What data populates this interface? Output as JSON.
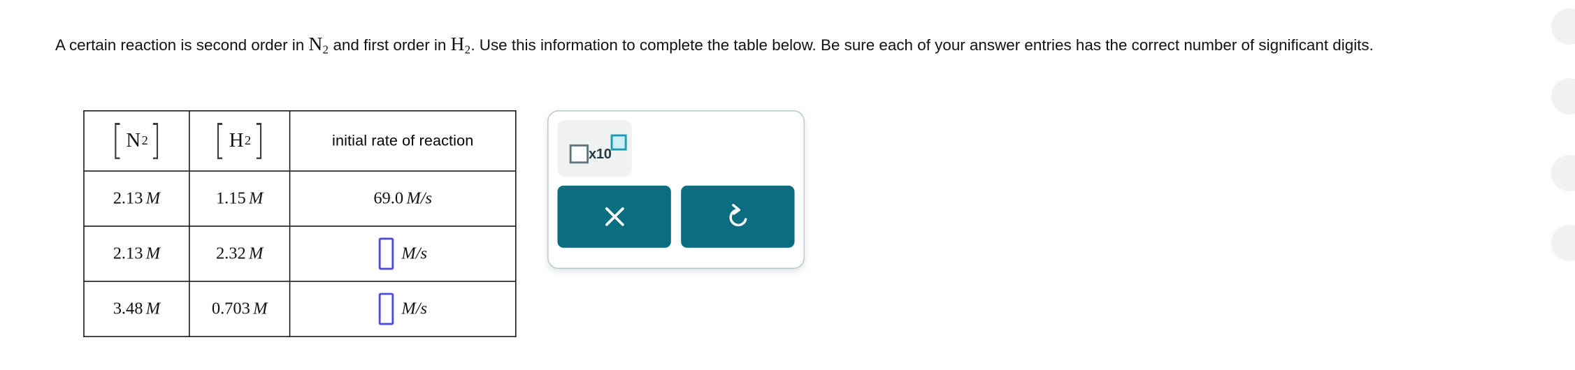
{
  "prompt": {
    "part1": "A certain reaction is second order in ",
    "species1": "N",
    "species1_sub": "2",
    "part2": " and first order in ",
    "species2": "H",
    "species2_sub": "2",
    "part3": ". Use this information to complete the table below. Be sure each of your answer entries has the correct number of significant digits."
  },
  "table": {
    "headers": [
      {
        "type": "species",
        "symbol": "N",
        "sub": "2",
        "bracket_open": "[",
        "bracket_close": "]"
      },
      {
        "type": "species",
        "symbol": "H",
        "sub": "2",
        "bracket_open": "[",
        "bracket_close": "]"
      },
      {
        "type": "text",
        "label": "initial rate of reaction"
      }
    ],
    "rows": [
      {
        "n2": "2.13",
        "n2_unit": "M",
        "h2": "1.15",
        "h2_unit": "M",
        "rate": "69.0",
        "rate_unit": "M/s",
        "rate_is_input": false,
        "rate_input_value": ""
      },
      {
        "n2": "2.13",
        "n2_unit": "M",
        "h2": "2.32",
        "h2_unit": "M",
        "rate": "",
        "rate_unit": "M/s",
        "rate_is_input": true,
        "rate_input_value": ""
      },
      {
        "n2": "3.48",
        "n2_unit": "M",
        "h2": "0.703",
        "h2_unit": "M",
        "rate": "",
        "rate_unit": "M/s",
        "rate_is_input": true,
        "rate_input_value": ""
      }
    ]
  },
  "palette": {
    "scientific_notation_label": "x10",
    "clear_label": "",
    "undo_label": "",
    "colors": {
      "teal_button": "#0a6e80",
      "cyan_box_border": "#189cb5",
      "cyan_box_fill": "#cfeef5",
      "gray_box_border": "#5f757d",
      "card_border": "#b6c7cc",
      "input_box_border": "#4d4dd8"
    }
  },
  "side_bubbles": {
    "count": 4
  }
}
